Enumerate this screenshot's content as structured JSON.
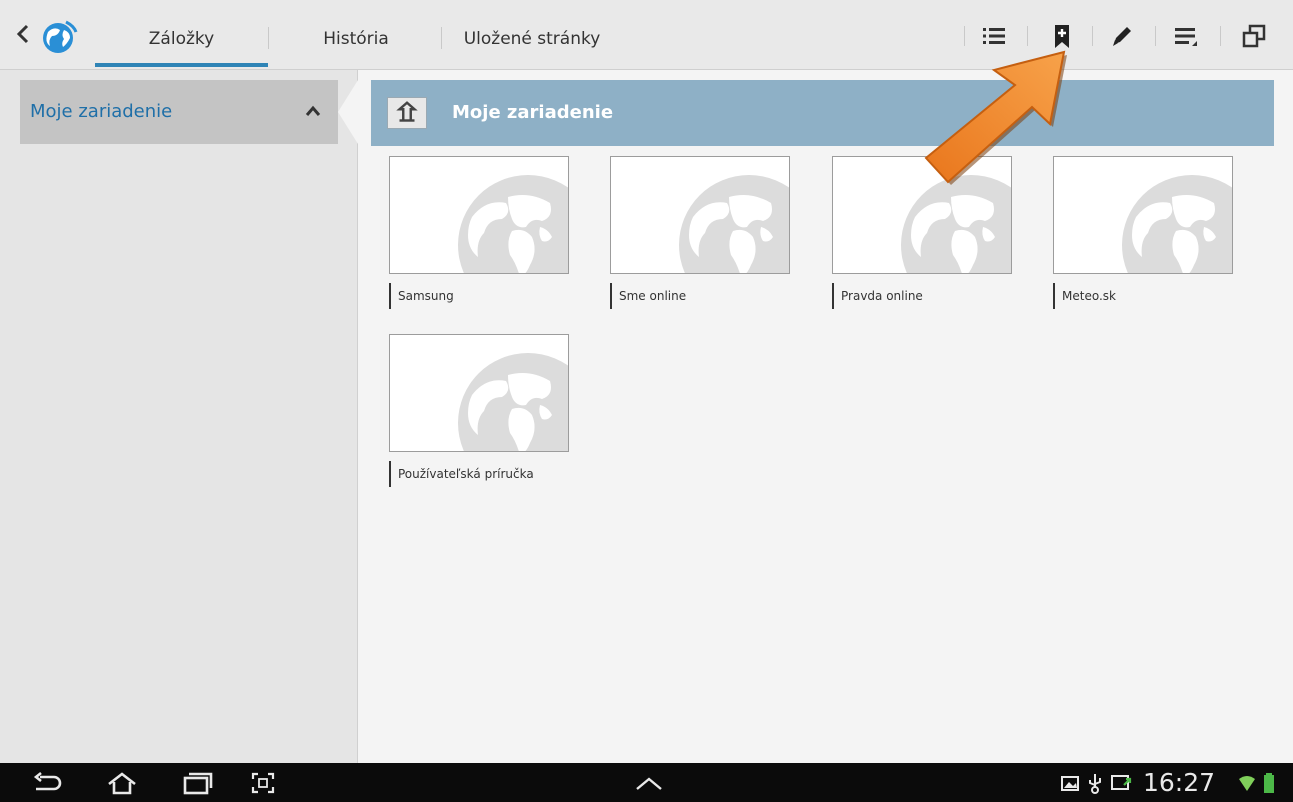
{
  "tabs": [
    {
      "label": "Záložky",
      "active": true
    },
    {
      "label": "História",
      "active": false
    },
    {
      "label": "Uložené stránky",
      "active": false
    }
  ],
  "toolbar_icons": [
    "list-view-icon",
    "add-bookmark-icon",
    "edit-icon",
    "menu-icon",
    "windows-icon"
  ],
  "sidebar": {
    "items": [
      {
        "label": "Moje zariadenie",
        "expanded": true
      }
    ]
  },
  "folder": {
    "title": "Moje zariadenie"
  },
  "bookmarks": [
    {
      "label": "Samsung"
    },
    {
      "label": "Sme online"
    },
    {
      "label": "Pravda online"
    },
    {
      "label": "Meteo.sk"
    },
    {
      "label": "Používateľská príručka"
    }
  ],
  "status": {
    "time": "16:27"
  },
  "colors": {
    "accent": "#2f84b6",
    "folder_header": "#8eb0c6",
    "arrow": "#f08a2c"
  }
}
